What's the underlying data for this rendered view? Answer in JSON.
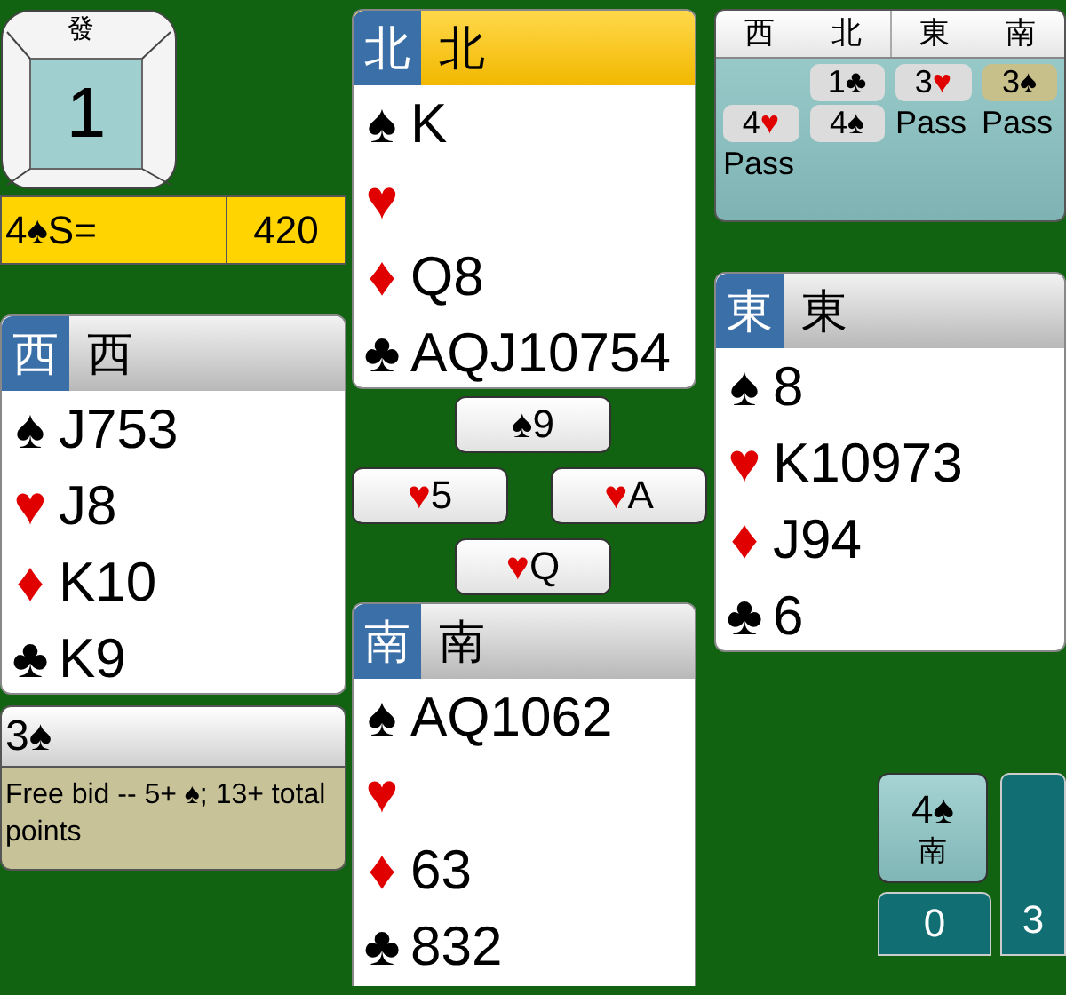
{
  "board": {
    "dealer_label": "發",
    "number": "1"
  },
  "contract": {
    "text": "4♠S=",
    "score": "420"
  },
  "hands": [
    {
      "badge": "西",
      "name": "西",
      "active": false,
      "suits": [
        {
          "red": false,
          "symbol": "♠",
          "cards": "J753"
        },
        {
          "red": true,
          "symbol": "♥",
          "cards": "J8"
        },
        {
          "red": true,
          "symbol": "♦",
          "cards": "K10"
        },
        {
          "red": false,
          "symbol": "♣",
          "cards": "K9"
        }
      ]
    },
    {
      "badge": "北",
      "name": "北",
      "active": true,
      "suits": [
        {
          "red": false,
          "symbol": "♠",
          "cards": "K"
        },
        {
          "red": true,
          "symbol": "♥"
        },
        {
          "red": true,
          "symbol": "♦",
          "cards": "Q8"
        },
        {
          "red": false,
          "symbol": "♣",
          "cards": "AQJ10754"
        }
      ]
    },
    {
      "badge": "東",
      "name": "東",
      "active": false,
      "suits": [
        {
          "red": false,
          "symbol": "♠",
          "cards": "8"
        },
        {
          "red": true,
          "symbol": "♥",
          "cards": "K10973"
        },
        {
          "red": true,
          "symbol": "♦",
          "cards": "J94"
        },
        {
          "red": false,
          "symbol": "♣",
          "cards": "6"
        }
      ]
    },
    {
      "badge": "南",
      "name": "南",
      "active": false,
      "suits": [
        {
          "red": false,
          "symbol": "♠",
          "cards": "AQ1062"
        },
        {
          "red": true,
          "symbol": "♥"
        },
        {
          "red": true,
          "symbol": "♦",
          "cards": "63"
        },
        {
          "red": false,
          "symbol": "♣",
          "cards": "832"
        }
      ]
    }
  ],
  "trick": [
    {
      "kind": "north",
      "red": false,
      "symbol": "♠",
      "rank": "9"
    },
    {
      "kind": "west",
      "red": true,
      "symbol": "♥",
      "rank": "5"
    },
    {
      "kind": "east",
      "red": true,
      "symbol": "♥",
      "rank": "A"
    },
    {
      "kind": "south",
      "red": true,
      "symbol": "♥",
      "rank": "Q"
    }
  ],
  "auction": {
    "columns": [
      "西",
      "北",
      "東",
      "南"
    ],
    "rows": [
      [
        {
          "kind": "empty"
        },
        {
          "kind": "bid",
          "level": "1",
          "symbol": "♣",
          "red": false,
          "selected": false
        },
        {
          "kind": "bid",
          "level": "3",
          "symbol": "♥",
          "red": true,
          "selected": false
        },
        {
          "kind": "bid",
          "level": "3",
          "symbol": "♠",
          "red": false,
          "selected": true
        }
      ],
      [
        {
          "kind": "bid",
          "level": "4",
          "symbol": "♥",
          "red": true,
          "selected": false
        },
        {
          "kind": "bid",
          "level": "4",
          "symbol": "♠",
          "red": false,
          "selected": false
        },
        {
          "kind": "pass",
          "text": "Pass"
        },
        {
          "kind": "pass",
          "text": "Pass"
        }
      ],
      [
        {
          "kind": "pass",
          "text": "Pass"
        }
      ]
    ]
  },
  "explanation": {
    "bid": "3♠",
    "text": "Free bid -- 5+ ♠; 13+ total points"
  },
  "last_bid": {
    "bid": "4♠",
    "seat": "南"
  },
  "score_tiles": [
    "0",
    "3"
  ]
}
